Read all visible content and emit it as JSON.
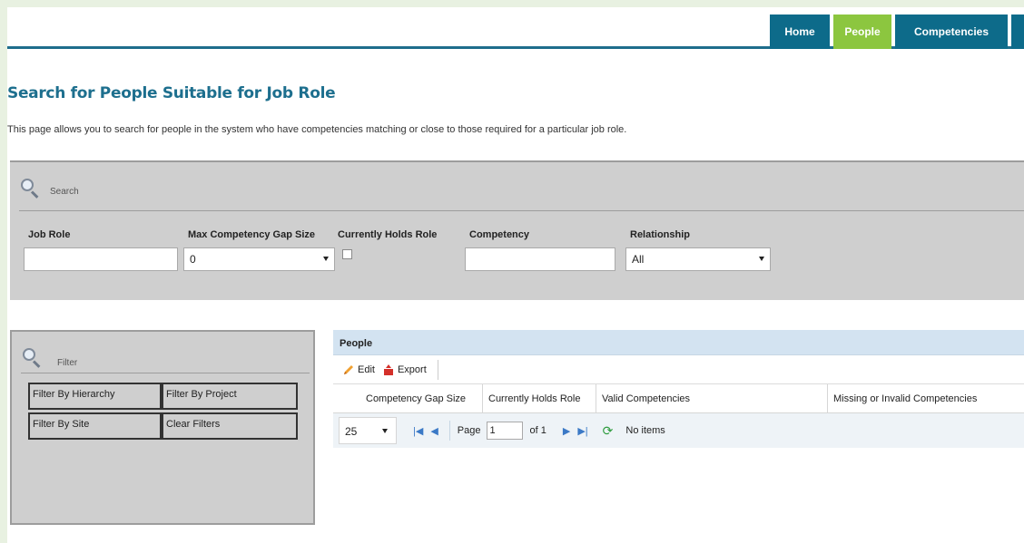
{
  "nav": {
    "tabs": [
      {
        "label": "Home"
      },
      {
        "label": "People"
      },
      {
        "label": "Competencies"
      }
    ]
  },
  "page": {
    "title": "Search for People Suitable for Job Role",
    "description": "This page allows you to search for people in the system who have competencies matching or close to those required for a particular job role."
  },
  "search": {
    "header": "Search",
    "fields": {
      "job_role": {
        "label": "Job Role",
        "value": ""
      },
      "max_gap": {
        "label": "Max Competency Gap Size",
        "value": "0"
      },
      "holds_role": {
        "label": "Currently Holds Role",
        "checked": false
      },
      "competency": {
        "label": "Competency",
        "value": ""
      },
      "relationship": {
        "label": "Relationship",
        "value": "All"
      }
    }
  },
  "filter": {
    "header": "Filter",
    "buttons": [
      "Filter By Hierarchy",
      "Filter By Project",
      "Filter By Site",
      "Clear Filters"
    ]
  },
  "grid": {
    "title": "People",
    "toolbar": {
      "edit": "Edit",
      "export": "Export"
    },
    "columns": [
      "Competency Gap Size",
      "Currently Holds Role",
      "Valid Competencies",
      "Missing or Invalid Competencies"
    ],
    "pager": {
      "page_size": "25",
      "page_label": "Page",
      "page_value": "1",
      "of_label": "of 1",
      "status": "No items"
    }
  },
  "colors": {
    "accent": "#0d6b8a",
    "active_tab": "#8cc63f",
    "title": "#1d6f8e",
    "panel": "#cfcfcf"
  }
}
